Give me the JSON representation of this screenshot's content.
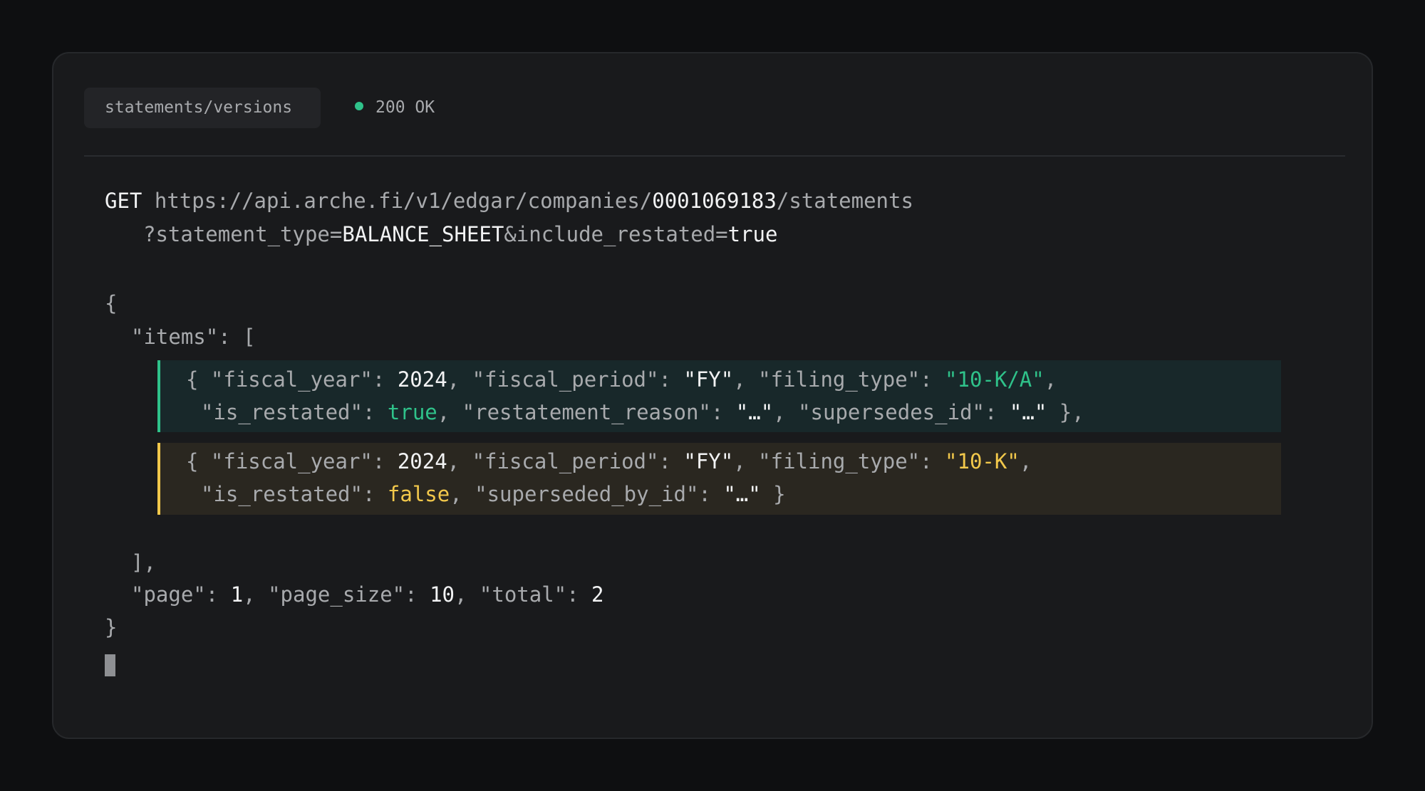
{
  "header": {
    "tab_label": "statements/versions",
    "status_text": "200 OK",
    "status_color": "#2fc28a"
  },
  "request": {
    "method": "GET",
    "url_base": "https://api.arche.fi/v1/edgar/companies/",
    "cik": "0001069183",
    "url_path": "/statements",
    "query_prefix": "?statement_type=",
    "statement_type": "BALANCE_SHEET",
    "query_sep": "&include_restated=",
    "include_restated": "true"
  },
  "response": {
    "open_brace": "{",
    "items_open": "\"items\": [",
    "item1": {
      "line1_a": "{ \"fiscal_year\": ",
      "fiscal_year": "2024",
      "line1_b": ", \"fiscal_period\": ",
      "fiscal_period": "\"FY\"",
      "line1_c": ", \"filing_type\": ",
      "filing_type": "\"10-K/A\"",
      "line1_d": ",",
      "line2_a": "\"is_restated\": ",
      "is_restated": "true",
      "line2_b": ", \"restatement_reason\": ",
      "restatement_reason": "\"…\"",
      "line2_c": ", \"supersedes_id\": ",
      "supersedes_id": "\"…\"",
      "line2_d": " },"
    },
    "item2": {
      "line1_a": "{ \"fiscal_year\": ",
      "fiscal_year": "2024",
      "line1_b": ", \"fiscal_period\": ",
      "fiscal_period": "\"FY\"",
      "line1_c": ", \"filing_type\": ",
      "filing_type": "\"10-K\"",
      "line1_d": ",",
      "line2_a": "\"is_restated\": ",
      "is_restated": "false",
      "line2_b": ", \"superseded_by_id\": ",
      "superseded_by_id": "\"…\"",
      "line2_c": " }"
    },
    "items_close": "],",
    "page_key": "\"page\": ",
    "page": "1",
    "page_size_key": ", \"page_size\": ",
    "page_size": "10",
    "total_key": ", \"total\": ",
    "total": "2",
    "close_brace": "}"
  },
  "colors": {
    "background": "#0e0f11",
    "panel": "#191a1c",
    "text_dim": "#a8aaad",
    "text_bright": "#f2f3f4",
    "accent_green": "#2fc28a",
    "accent_yellow": "#f2c84b"
  }
}
